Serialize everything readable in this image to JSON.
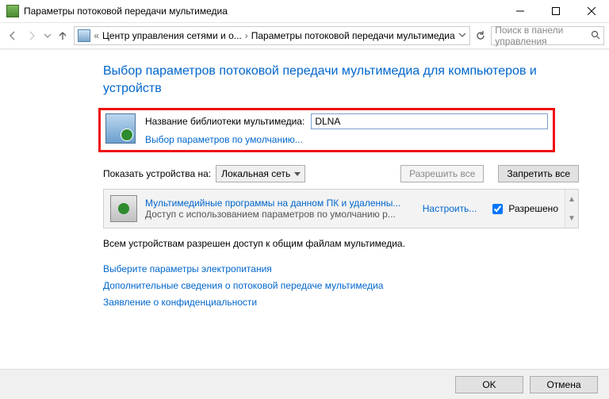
{
  "window": {
    "title": "Параметры потоковой передачи мультимедиа"
  },
  "breadcrumb": {
    "item1": "Центр управления сетями и о...",
    "item2": "Параметры потоковой передачи мультимедиа"
  },
  "search": {
    "placeholder": "Поиск в панели управления"
  },
  "heading": "Выбор параметров потоковой передачи мультимедиа для компьютеров и устройств",
  "library": {
    "label": "Название библиотеки мультимедиа:",
    "value": "DLNA",
    "defaults_link": "Выбор параметров по умолчанию..."
  },
  "show_on": {
    "label": "Показать устройства на:",
    "selected": "Локальная сеть"
  },
  "buttons": {
    "allow_all": "Разрешить все",
    "block_all": "Запретить все",
    "ok": "OK",
    "cancel": "Отмена"
  },
  "device": {
    "title": "Мультимедийные программы на данном ПК и удаленны...",
    "subtitle": "Доступ с использованием параметров по умолчанию р...",
    "customize": "Настроить...",
    "allowed_label": "Разрешено"
  },
  "note": "Всем устройствам разрешен доступ к общим файлам мультимедиа.",
  "links": {
    "power": "Выберите параметры электропитания",
    "more": "Дополнительные сведения о потоковой передаче мультимедиа",
    "privacy": "Заявление о конфиденциальности"
  }
}
